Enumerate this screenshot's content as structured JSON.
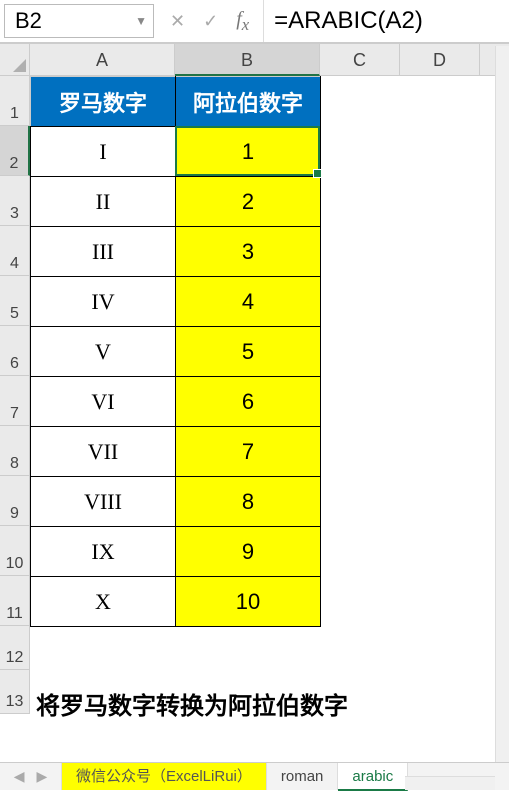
{
  "formula_bar": {
    "cell_ref": "B2",
    "formula": "=ARABIC(A2)"
  },
  "columns": [
    "A",
    "B",
    "C",
    "D"
  ],
  "rows": [
    "1",
    "2",
    "3",
    "4",
    "5",
    "6",
    "7",
    "8",
    "9",
    "10",
    "11",
    "12",
    "13"
  ],
  "headers": {
    "colA": "罗马数字",
    "colB": "阿拉伯数字"
  },
  "data_rows": [
    {
      "roman": "I",
      "arabic": "1"
    },
    {
      "roman": "II",
      "arabic": "2"
    },
    {
      "roman": "III",
      "arabic": "3"
    },
    {
      "roman": "IV",
      "arabic": "4"
    },
    {
      "roman": "V",
      "arabic": "5"
    },
    {
      "roman": "VI",
      "arabic": "6"
    },
    {
      "roman": "VII",
      "arabic": "7"
    },
    {
      "roman": "VIII",
      "arabic": "8"
    },
    {
      "roman": "IX",
      "arabic": "9"
    },
    {
      "roman": "X",
      "arabic": "10"
    }
  ],
  "caption": "将罗马数字转换为阿拉伯数字",
  "tabs": {
    "t1": "微信公众号（ExcelLiRui）",
    "t2": "roman",
    "t3": "arabic"
  }
}
